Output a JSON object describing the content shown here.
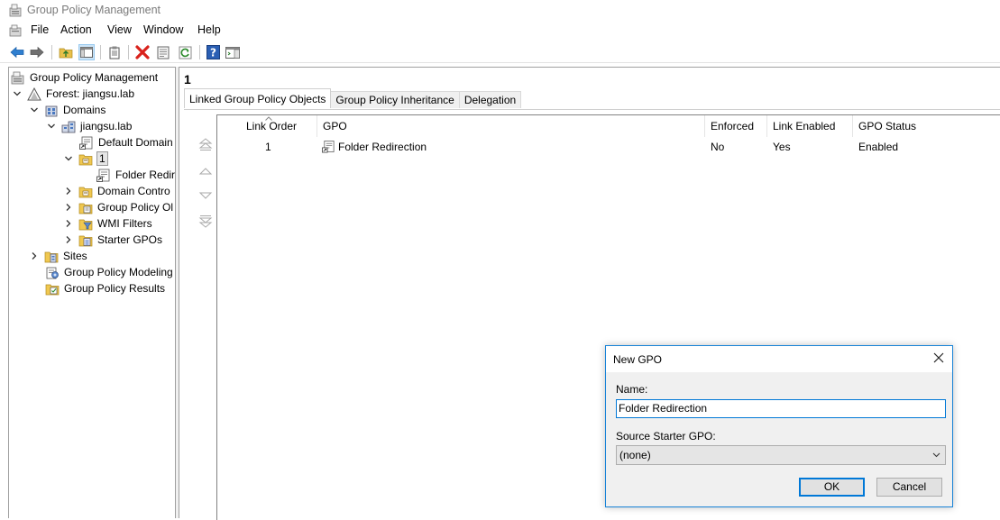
{
  "window": {
    "title": "Group Policy Management"
  },
  "menu": [
    "File",
    "Action",
    "View",
    "Window",
    "Help"
  ],
  "toolbar": {
    "icons": [
      "back-arrow-icon",
      "forward-arrow-icon",
      "up-folder-icon",
      "show-hide-tree-icon",
      "clipboard-icon",
      "delete-icon",
      "properties-icon",
      "refresh-icon",
      "help-icon",
      "action-pane-icon"
    ]
  },
  "tree": {
    "root": "Group Policy Management",
    "forest": "Forest: jiangsu.lab",
    "domains": "Domains",
    "domain": "jiangsu.lab",
    "default_domain": "Default Domain",
    "ou": "1",
    "ou_child": "Folder Redir",
    "domain_controllers": "Domain Contro",
    "gpo_objects": "Group Policy Ol",
    "wmi_filters": "WMI Filters",
    "starter_gpos": "Starter GPOs",
    "sites": "Sites",
    "modeling": "Group Policy Modeling",
    "results": "Group Policy Results"
  },
  "main": {
    "heading": "1",
    "tabs": [
      "Linked Group Policy Objects",
      "Group Policy Inheritance",
      "Delegation"
    ],
    "active_tab": "Linked Group Policy Objects",
    "columns": [
      "Link Order",
      "GPO",
      "Enforced",
      "Link Enabled",
      "GPO Status"
    ],
    "rows": [
      {
        "link_order": "1",
        "gpo": "Folder Redirection",
        "enforced": "No",
        "link_enabled": "Yes",
        "gpo_status": "Enabled"
      }
    ]
  },
  "dialog": {
    "title": "New GPO",
    "name_label": "Name:",
    "name_value": "Folder Redirection",
    "starter_label": "Source Starter GPO:",
    "starter_value": "(none)",
    "ok": "OK",
    "cancel": "Cancel"
  },
  "colors": {
    "accent": "#0078d7",
    "delete_red": "#d9221c",
    "help_blue": "#2b5fb4"
  }
}
